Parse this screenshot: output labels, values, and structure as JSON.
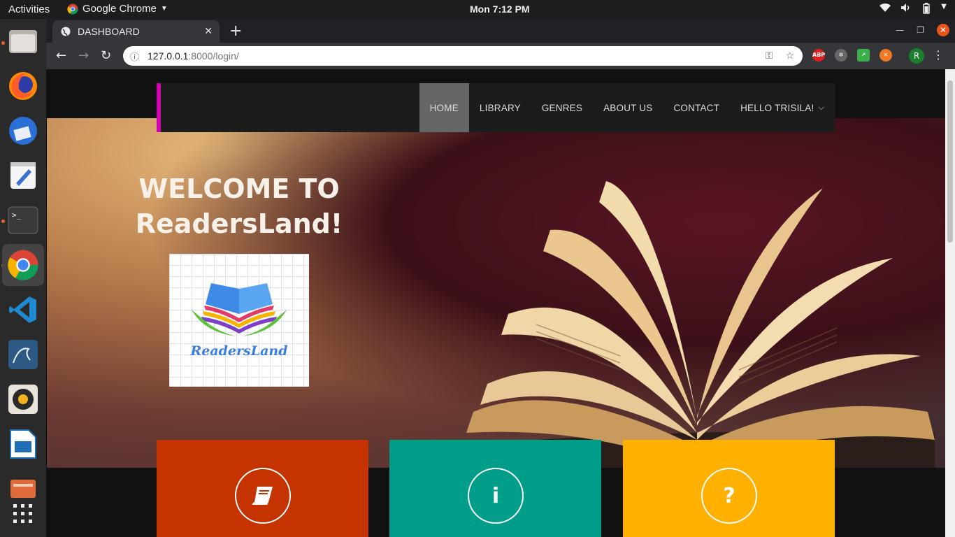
{
  "system": {
    "activities": "Activities",
    "app_name": "Google Chrome",
    "clock": "Mon  7:12 PM"
  },
  "browser": {
    "tab_title": "DASHBOARD",
    "url_host": "127.0.0.1",
    "url_path": ":8000/login/",
    "profile_initial": "R",
    "ext_abp": "ABP"
  },
  "site": {
    "menu": [
      {
        "label": "HOME",
        "active": true
      },
      {
        "label": "LIBRARY"
      },
      {
        "label": "GENRES"
      },
      {
        "label": "ABOUT US"
      },
      {
        "label": "CONTACT"
      },
      {
        "label": "HELLO TRISILA!"
      }
    ],
    "welcome_line1": "WELCOME TO",
    "welcome_line2": "ReadersLand!",
    "logo_text": "ReadersLand",
    "cards": [
      {
        "icon": "book-icon",
        "color": "#c43300"
      },
      {
        "icon": "info-icon",
        "glyph": "i",
        "color": "#009e89"
      },
      {
        "icon": "question-icon",
        "glyph": "?",
        "color": "#ffb000"
      }
    ],
    "accent_color": "#d000b0"
  }
}
